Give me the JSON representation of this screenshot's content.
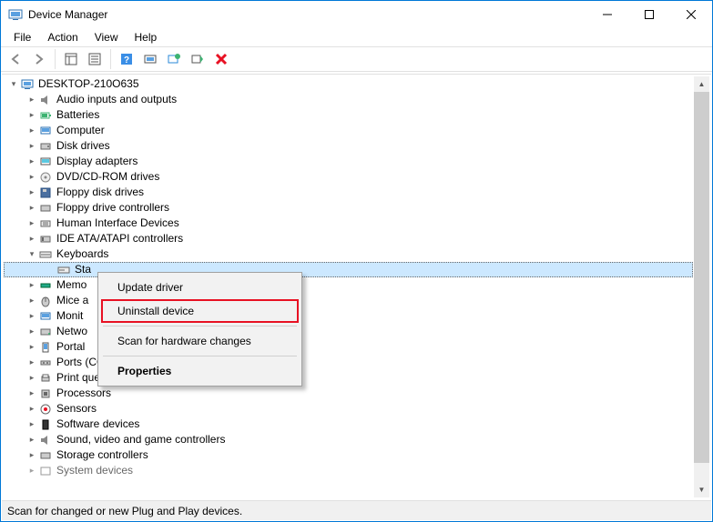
{
  "window": {
    "title": "Device Manager"
  },
  "menubar": {
    "file": "File",
    "action": "Action",
    "view": "View",
    "help": "Help"
  },
  "tree": {
    "root": "DESKTOP-210O635",
    "categories": [
      "Audio inputs and outputs",
      "Batteries",
      "Computer",
      "Disk drives",
      "Display adapters",
      "DVD/CD-ROM drives",
      "Floppy disk drives",
      "Floppy drive controllers",
      "Human Interface Devices",
      "IDE ATA/ATAPI controllers",
      "Keyboards",
      "Memory devices",
      "Mice and other pointing devices",
      "Monitors",
      "Network adapters",
      "Portable Devices",
      "Ports (COM & LPT)",
      "Print queues",
      "Processors",
      "Sensors",
      "Software devices",
      "Sound, video and game controllers",
      "Storage controllers",
      "System devices"
    ],
    "keyboard_child_prefix": "Sta",
    "truncated": {
      "memory": "Memo",
      "mice": "Mice a",
      "monitors": "Monit",
      "network": "Netwo",
      "portable": "Portal"
    }
  },
  "context_menu": {
    "update": "Update driver",
    "uninstall": "Uninstall device",
    "scan": "Scan for hardware changes",
    "properties": "Properties"
  },
  "statusbar": {
    "text": "Scan for changed or new Plug and Play devices."
  }
}
